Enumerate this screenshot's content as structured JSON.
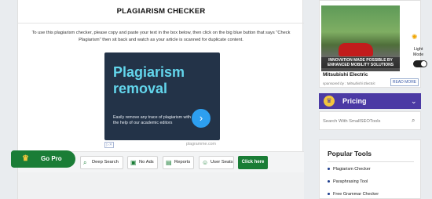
{
  "page": {
    "title": "PLAGIARISM CHECKER",
    "intro": "To use this plagiarism checker, please copy and paste your text in the box below, then click on the big blue button that says \"Check Plagiarism\" then sit back and watch as your article is scanned for duplicate content."
  },
  "ad": {
    "headline_line1": "Plagiarism",
    "headline_line2": "removal",
    "description": "Easily remove any trace of plagiarism with the help of our academic editors",
    "cta_icon": "chevron-right-icon",
    "choices_label": "▷✕",
    "domain": "plagramme.com"
  },
  "toolbar": {
    "gopro_label": "Go Pro",
    "buttons": [
      {
        "label": "Deep Search",
        "icon": "search-icon"
      },
      {
        "label": "No Ads",
        "icon": "no-ads-icon"
      },
      {
        "label": "Reports",
        "icon": "reports-icon"
      },
      {
        "label": "User Seats",
        "icon": "users-icon"
      }
    ],
    "click_label": "Click here"
  },
  "sidebar": {
    "ad": {
      "caption_line1": "INNOVATION MADE POSSIBLE BY",
      "caption_line2": "ENHANCED MOBILITY SOLUTIONS",
      "title": "Mitsubishi Electric",
      "sponsor": "sponsored by : Mitsubishi Electric",
      "read_more": "READ MORE"
    },
    "light_mode": {
      "line1": "Light",
      "line2": "Mode"
    },
    "pricing_label": "Pricing",
    "search_placeholder": "Search With SmallSEOTools",
    "popular_title": "Popular Tools",
    "popular_items": [
      "Plagiarism Checker",
      "Paraphrasing Tool",
      "Free Grammar Checker"
    ]
  },
  "colors": {
    "green": "#1a7d36",
    "purple": "#4b3aa4",
    "ad_bg": "#233348",
    "ad_headline": "#63d6ec"
  }
}
